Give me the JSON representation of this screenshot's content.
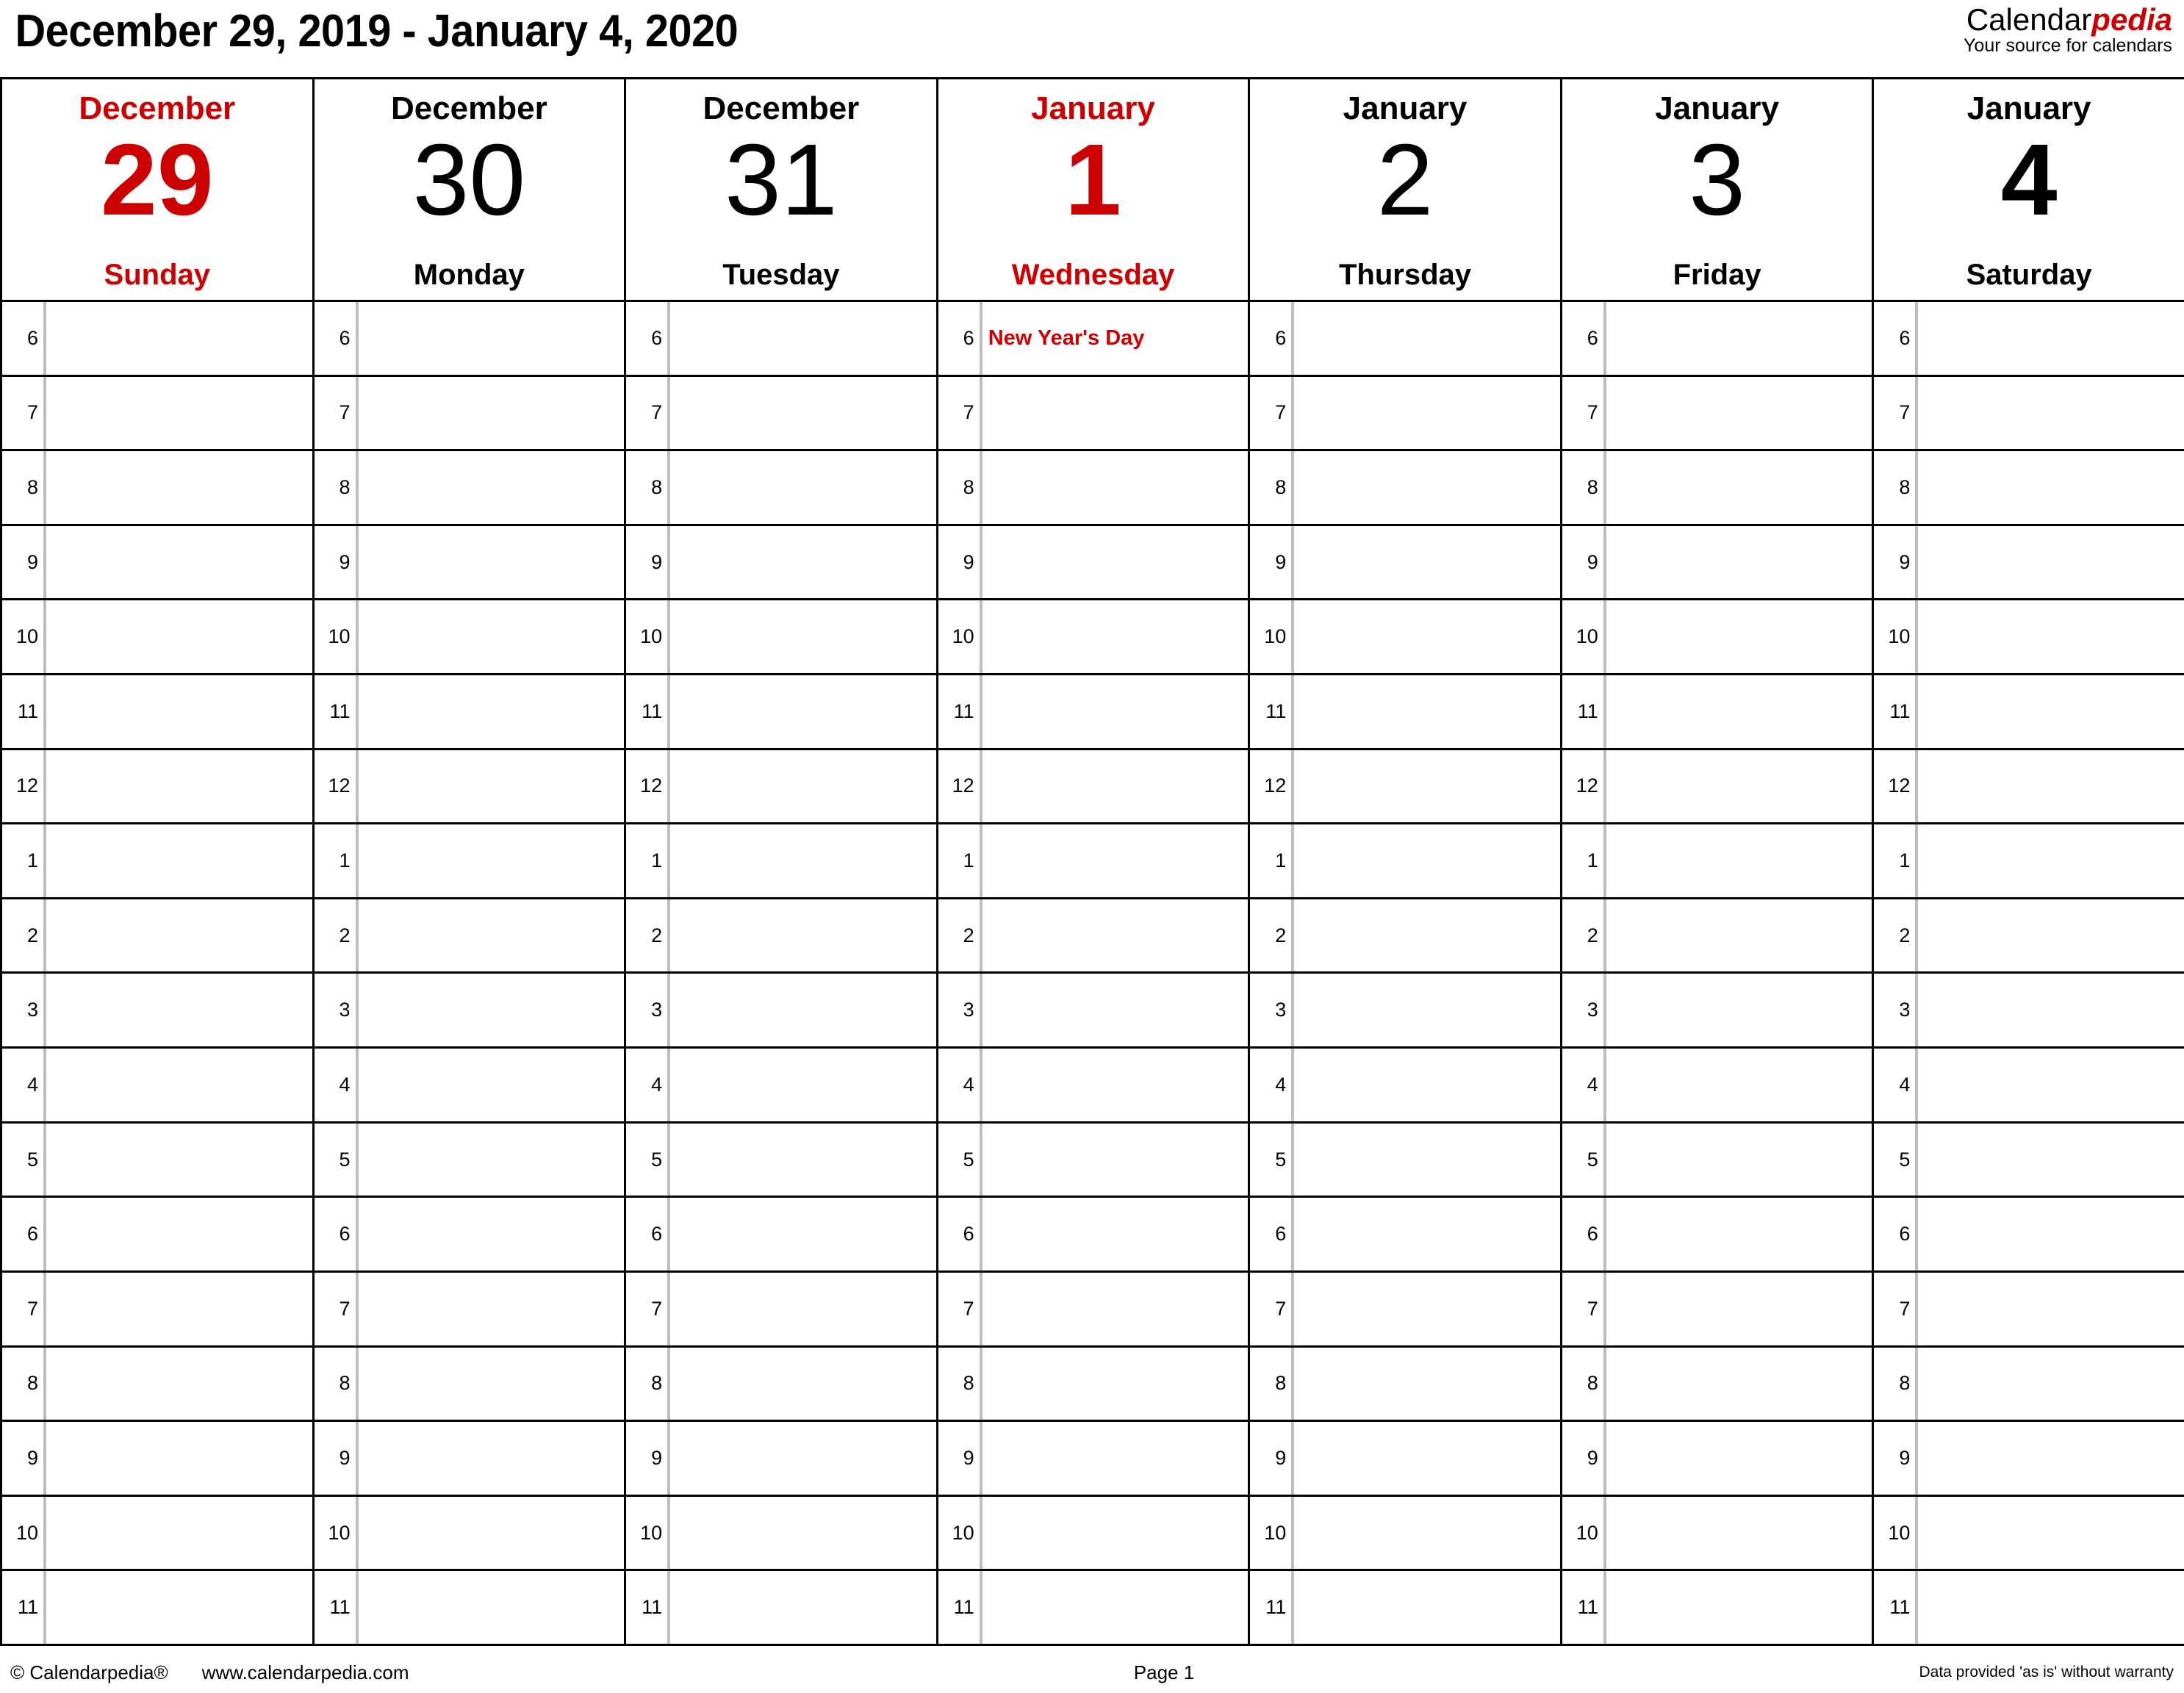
{
  "header": {
    "title": "December 29, 2019 - January 4, 2020",
    "brand_name_black": "Calendar",
    "brand_name_red": "pedia",
    "brand_tagline": "Your source for calendars"
  },
  "colors": {
    "accent_red": "#CC0000",
    "text_black": "#000000",
    "grid_line": "#000000",
    "hour_divider": "#BEBEBE",
    "background": "#FFFFFF"
  },
  "days": [
    {
      "month": "December",
      "number": "29",
      "weekday": "Sunday",
      "style": "holiday"
    },
    {
      "month": "December",
      "number": "30",
      "weekday": "Monday",
      "style": "weekday"
    },
    {
      "month": "December",
      "number": "31",
      "weekday": "Tuesday",
      "style": "weekday"
    },
    {
      "month": "January",
      "number": "1",
      "weekday": "Wednesday",
      "style": "holiday"
    },
    {
      "month": "January",
      "number": "2",
      "weekday": "Thursday",
      "style": "weekday"
    },
    {
      "month": "January",
      "number": "3",
      "weekday": "Friday",
      "style": "weekday"
    },
    {
      "month": "January",
      "number": "4",
      "weekday": "Saturday",
      "style": "weekend"
    }
  ],
  "hours": [
    "6",
    "7",
    "8",
    "9",
    "10",
    "11",
    "12",
    "1",
    "2",
    "3",
    "4",
    "5",
    "6",
    "7",
    "8",
    "9",
    "10",
    "11"
  ],
  "events": [
    {
      "day_index": 3,
      "hour_index": 0,
      "label": "New Year's Day"
    }
  ],
  "footer": {
    "copyright": "© Calendarpedia®",
    "website": "www.calendarpedia.com",
    "page": "Page 1",
    "disclaimer": "Data provided 'as is' without warranty"
  }
}
